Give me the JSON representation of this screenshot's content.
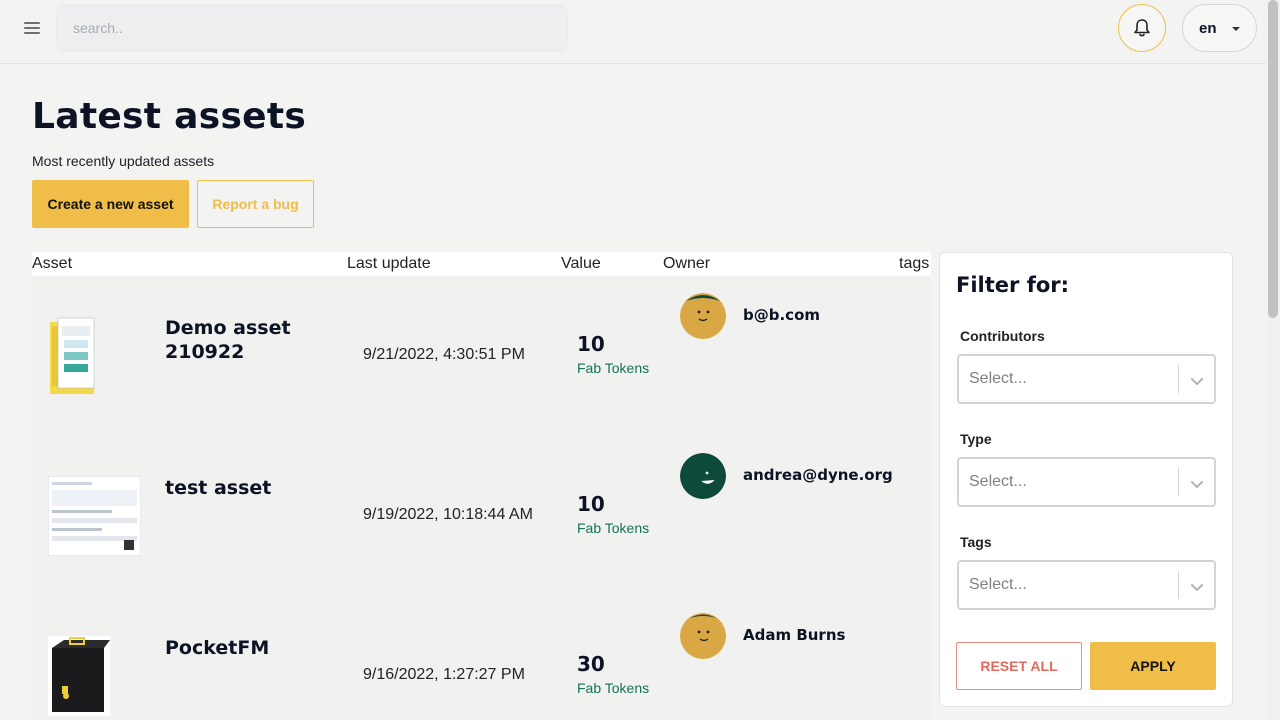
{
  "topbar": {
    "menu_icon": "hamburger-icon",
    "search_placeholder": "search..",
    "notification_icon": "bell-icon",
    "language": "en"
  },
  "page": {
    "title": "Latest assets",
    "subtitle": "Most recently updated assets",
    "create_button": "Create a new asset",
    "report_button": "Report a bug"
  },
  "table": {
    "headers": {
      "asset": "Asset",
      "last_update": "Last update",
      "value": "Value",
      "owner": "Owner",
      "tags": "tags"
    },
    "rows": [
      {
        "name": "Demo asset 210922",
        "date": "9/21/2022, 4:30:51 PM",
        "value": "10",
        "unit": "Fab Tokens",
        "owner": "b@b.com",
        "avatar_color": "#d9a845"
      },
      {
        "name": "test asset",
        "date": "9/19/2022, 10:18:44 AM",
        "value": "10",
        "unit": "Fab Tokens",
        "owner": "andrea@dyne.org",
        "avatar_color": "#0d4a3c"
      },
      {
        "name": "PocketFM",
        "date": "9/16/2022, 1:27:27 PM",
        "value": "30",
        "unit": "Fab Tokens",
        "owner": "Adam Burns",
        "avatar_color": "#d9a845"
      }
    ]
  },
  "filter": {
    "title": "Filter for:",
    "contributors_label": "Contributors",
    "type_label": "Type",
    "tags_label": "Tags",
    "select_placeholder": "Select...",
    "reset_button": "RESET ALL",
    "apply_button": "APPLY"
  },
  "colors": {
    "accent": "#f0bd48",
    "token_text": "#12735a",
    "reset": "#e06a5f"
  }
}
